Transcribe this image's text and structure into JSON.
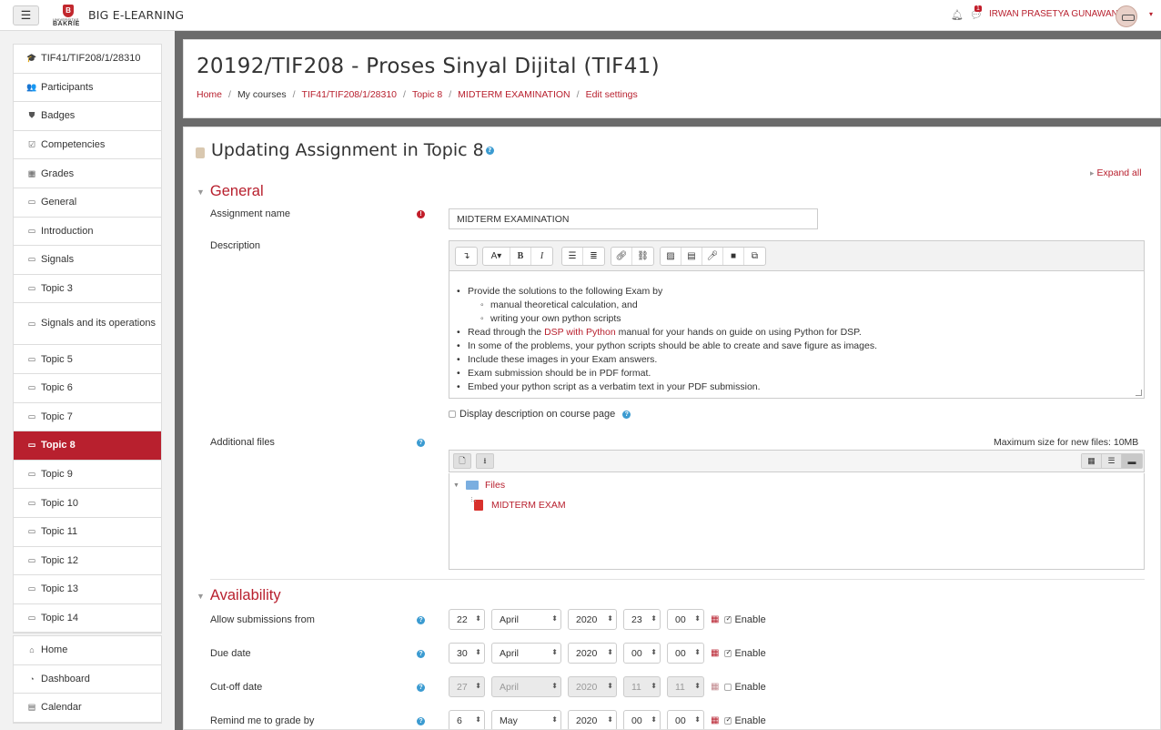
{
  "navbar": {
    "menu_icon": "hamburger-icon",
    "logo_mark": "B",
    "logo_sub": "UNIVERSITAS",
    "logo_text": "BAKRIE",
    "site_name": "BIG E-LEARNING",
    "notification_icon": "bell-icon",
    "message_icon": "comment-icon",
    "message_count": "1",
    "user_name": "IRWAN PRASETYA GUNAWAN",
    "user_caret": "▾"
  },
  "drawer": {
    "course_items": [
      {
        "icon": "graduation-cap-icon",
        "glyph": "🎓",
        "label": "TIF41/TIF208/1/28310"
      },
      {
        "icon": "users-icon",
        "glyph": "👥",
        "label": "Participants"
      },
      {
        "icon": "shield-icon",
        "glyph": "⛊",
        "label": "Badges"
      },
      {
        "icon": "check-square-icon",
        "glyph": "☑",
        "label": "Competencies"
      },
      {
        "icon": "table-icon",
        "glyph": "▦",
        "label": "Grades"
      },
      {
        "icon": "folder-icon",
        "glyph": "▭",
        "label": "General"
      },
      {
        "icon": "folder-icon",
        "glyph": "▭",
        "label": "Introduction"
      },
      {
        "icon": "folder-icon",
        "glyph": "▭",
        "label": "Signals"
      },
      {
        "icon": "folder-icon",
        "glyph": "▭",
        "label": "Topic 3"
      },
      {
        "icon": "folder-icon",
        "glyph": "▭",
        "label": "Signals and its operations"
      },
      {
        "icon": "folder-icon",
        "glyph": "▭",
        "label": "Topic 5"
      },
      {
        "icon": "folder-icon",
        "glyph": "▭",
        "label": "Topic 6"
      },
      {
        "icon": "folder-icon",
        "glyph": "▭",
        "label": "Topic 7"
      },
      {
        "icon": "folder-icon",
        "glyph": "▭",
        "label": "Topic 8"
      },
      {
        "icon": "folder-icon",
        "glyph": "▭",
        "label": "Topic 9"
      },
      {
        "icon": "folder-icon",
        "glyph": "▭",
        "label": "Topic 10"
      },
      {
        "icon": "folder-icon",
        "glyph": "▭",
        "label": "Topic 11"
      },
      {
        "icon": "folder-icon",
        "glyph": "▭",
        "label": "Topic 12"
      },
      {
        "icon": "folder-icon",
        "glyph": "▭",
        "label": "Topic 13"
      },
      {
        "icon": "folder-icon",
        "glyph": "▭",
        "label": "Topic 14"
      }
    ],
    "active_item": "Topic 8",
    "site_items": [
      {
        "icon": "home-icon",
        "glyph": "⌂",
        "label": "Home"
      },
      {
        "icon": "dashboard-icon",
        "glyph": "◔",
        "label": "Dashboard"
      },
      {
        "icon": "calendar-icon",
        "glyph": "▤",
        "label": "Calendar"
      }
    ]
  },
  "header": {
    "course_title": "20192/TIF208 - Proses Sinyal Dijital (TIF41)",
    "breadcrumb": [
      "Home",
      "My courses",
      "TIF41/TIF208/1/28310",
      "Topic 8",
      "MIDTERM EXAMINATION",
      "Edit settings"
    ]
  },
  "form": {
    "heading": "Updating Assignment in Topic 8",
    "expand_all": "Expand all",
    "sections": {
      "general": "General",
      "availability": "Availability"
    },
    "assignment_name_label": "Assignment name",
    "assignment_name_value": "MIDTERM EXAMINATION",
    "description_label": "Description",
    "description": {
      "items": [
        "Provide the solutions to the following Exam by",
        "manual theoretical calculation, and",
        "writing your own python scripts",
        "Read through the ",
        "DSP with Python",
        " manual for your hands on guide on using Python for DSP.",
        "In some of the problems, your python scripts should be able to create and save figure as images.",
        "Include these images in your Exam answers.",
        "Exam submission should be in PDF format.",
        "Embed your python script as a verbatim text in your PDF submission."
      ]
    },
    "display_description_label": "Display description on course page",
    "additional_files_label": "Additional files",
    "max_size": "Maximum size for new files: 10MB",
    "files_folder": "Files",
    "file_name": "MIDTERM EXAM",
    "dates": [
      {
        "label": "Allow submissions from",
        "day": "22",
        "month": "April",
        "year": "2020",
        "hour": "23",
        "minute": "00",
        "enabled": true
      },
      {
        "label": "Due date",
        "day": "30",
        "month": "April",
        "year": "2020",
        "hour": "00",
        "minute": "00",
        "enabled": true
      },
      {
        "label": "Cut-off date",
        "day": "27",
        "month": "April",
        "year": "2020",
        "hour": "11",
        "minute": "11",
        "enabled": false
      },
      {
        "label": "Remind me to grade by",
        "day": "6",
        "month": "May",
        "year": "2020",
        "hour": "00",
        "minute": "00",
        "enabled": true
      }
    ],
    "enable_label": "Enable"
  },
  "colors": {
    "accent": "#b8202e",
    "help": "#3b9bd1"
  }
}
